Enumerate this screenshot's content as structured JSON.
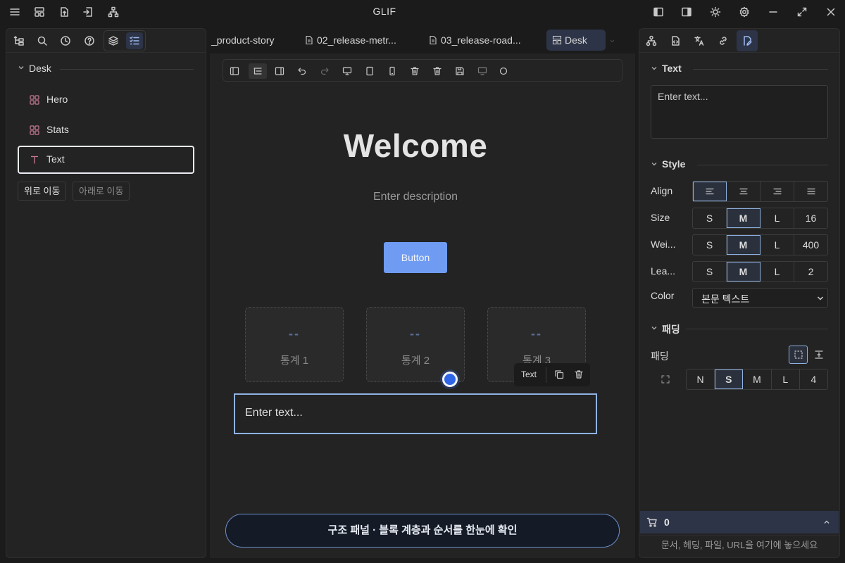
{
  "app": {
    "title": "GLIF"
  },
  "tree": {
    "root_label": "Desk",
    "items": [
      {
        "label": "Hero",
        "icon": "grid-icon"
      },
      {
        "label": "Stats",
        "icon": "grid-icon"
      },
      {
        "label": "Text",
        "icon": "text-type-icon",
        "selected": true
      }
    ],
    "move_up": "위로 이동",
    "move_down": "아래로 이동"
  },
  "tabs": [
    {
      "label": "_product-story"
    },
    {
      "label": "02_release-metr..."
    },
    {
      "label": "03_release-road..."
    },
    {
      "label": "Desk",
      "active": true
    }
  ],
  "canvas": {
    "hero_title": "Welcome",
    "hero_description": "Enter description",
    "hero_button": "Button",
    "stats": [
      {
        "value": "--",
        "label": "통계 1"
      },
      {
        "value": "--",
        "label": "통계 2"
      },
      {
        "value": "--",
        "label": "통계 3"
      }
    ],
    "float_toolbar_label": "Text",
    "text_block": "Enter text...",
    "tip": "구조 패널 · 블록 계층과 순서를 한눈에 확인"
  },
  "inspector": {
    "text_section": "Text",
    "text_placeholder": "Enter text...",
    "style_section": "Style",
    "align_label": "Align",
    "align_options": [
      "left",
      "center",
      "right",
      "justify"
    ],
    "align_selected": "left",
    "size_label": "Size",
    "size_options": [
      "S",
      "M",
      "L",
      "16"
    ],
    "size_selected": "M",
    "weight_label": "Wei...",
    "weight_options": [
      "S",
      "M",
      "L",
      "400"
    ],
    "weight_selected": "M",
    "leading_label": "Lea...",
    "leading_options": [
      "S",
      "M",
      "L",
      "2"
    ],
    "leading_selected": "M",
    "color_label": "Color",
    "color_value": "본문 텍스트",
    "padding_section": "패딩",
    "padding_label": "패딩",
    "padding_options": [
      "N",
      "S",
      "M",
      "L",
      "4"
    ],
    "padding_selected": "S"
  },
  "basket": {
    "count": "0",
    "drop_hint": "문서, 헤딩, 파일, URL을 여기에 놓으세요"
  },
  "colors": {
    "background": "#1b1b1b",
    "panel": "#232323",
    "accent": "#6f9bf2",
    "active_tab": "#2d3447",
    "selection_border": "#8fb2e3",
    "handle": "#2f66e6"
  }
}
